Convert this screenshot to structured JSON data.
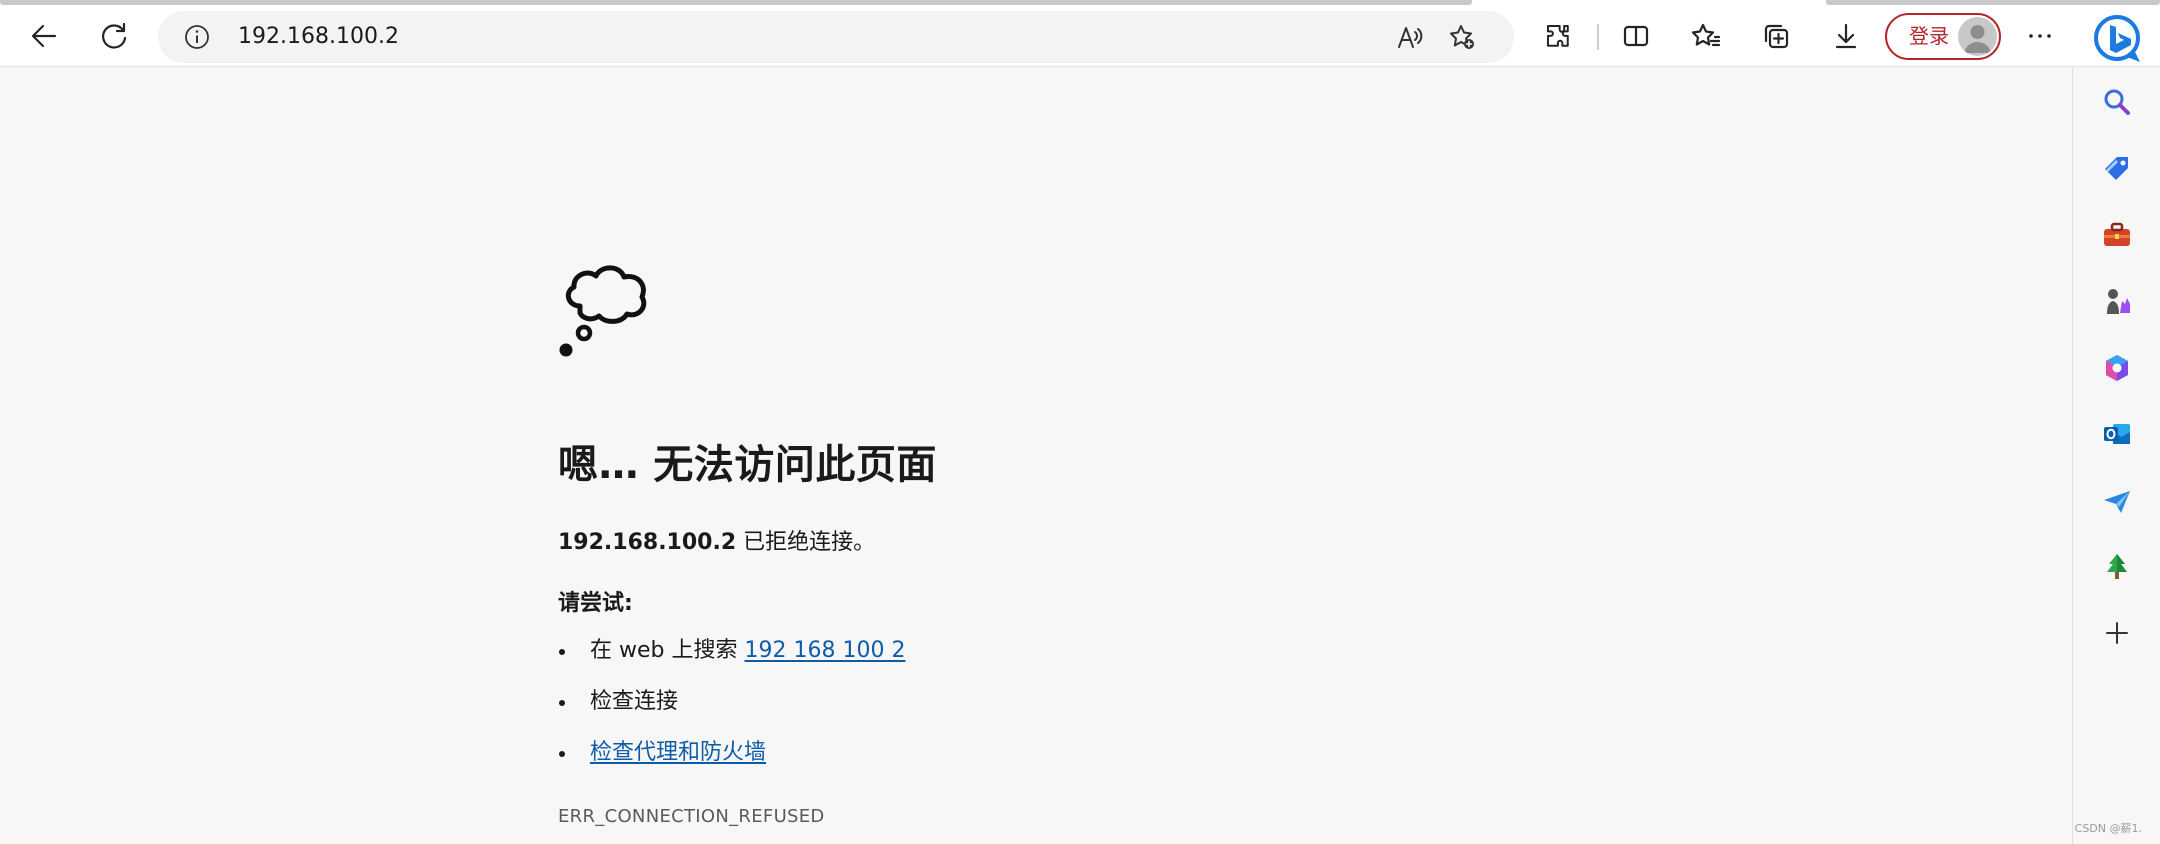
{
  "browser": {
    "address": {
      "url": "192.168.100.2"
    },
    "login_label": "登录"
  },
  "toolbar_icons": [
    "back-icon",
    "refresh-icon",
    "info-icon",
    "read-aloud-icon",
    "add-favorite-icon",
    "extensions-icon",
    "split-screen-icon",
    "favorites-icon",
    "collections-icon",
    "downloads-icon",
    "more-icon",
    "bing-icon"
  ],
  "sidebar_icons": [
    "search-icon",
    "shopping-tag-icon",
    "tools-icon",
    "games-icon",
    "office-icon",
    "outlook-icon",
    "drop-icon",
    "tree-icon",
    "add-icon"
  ],
  "error_page": {
    "title": "嗯… 无法访问此页面",
    "host": "192.168.100.2",
    "message": " 已拒绝连接。",
    "try_heading": "请尝试:",
    "suggestion_1_prefix": "在 web 上搜索 ",
    "suggestion_1_link": "192 168 100 2",
    "suggestion_2": "检查连接",
    "suggestion_3_link": "检查代理和防火墙",
    "error_code": "ERR_CONNECTION_REFUSED"
  },
  "watermark": "CSDN @薪1.",
  "colors": {
    "accent_link": "#0e5ca8",
    "login_red": "#b3262a",
    "page_bg": "#f7f7f7"
  }
}
